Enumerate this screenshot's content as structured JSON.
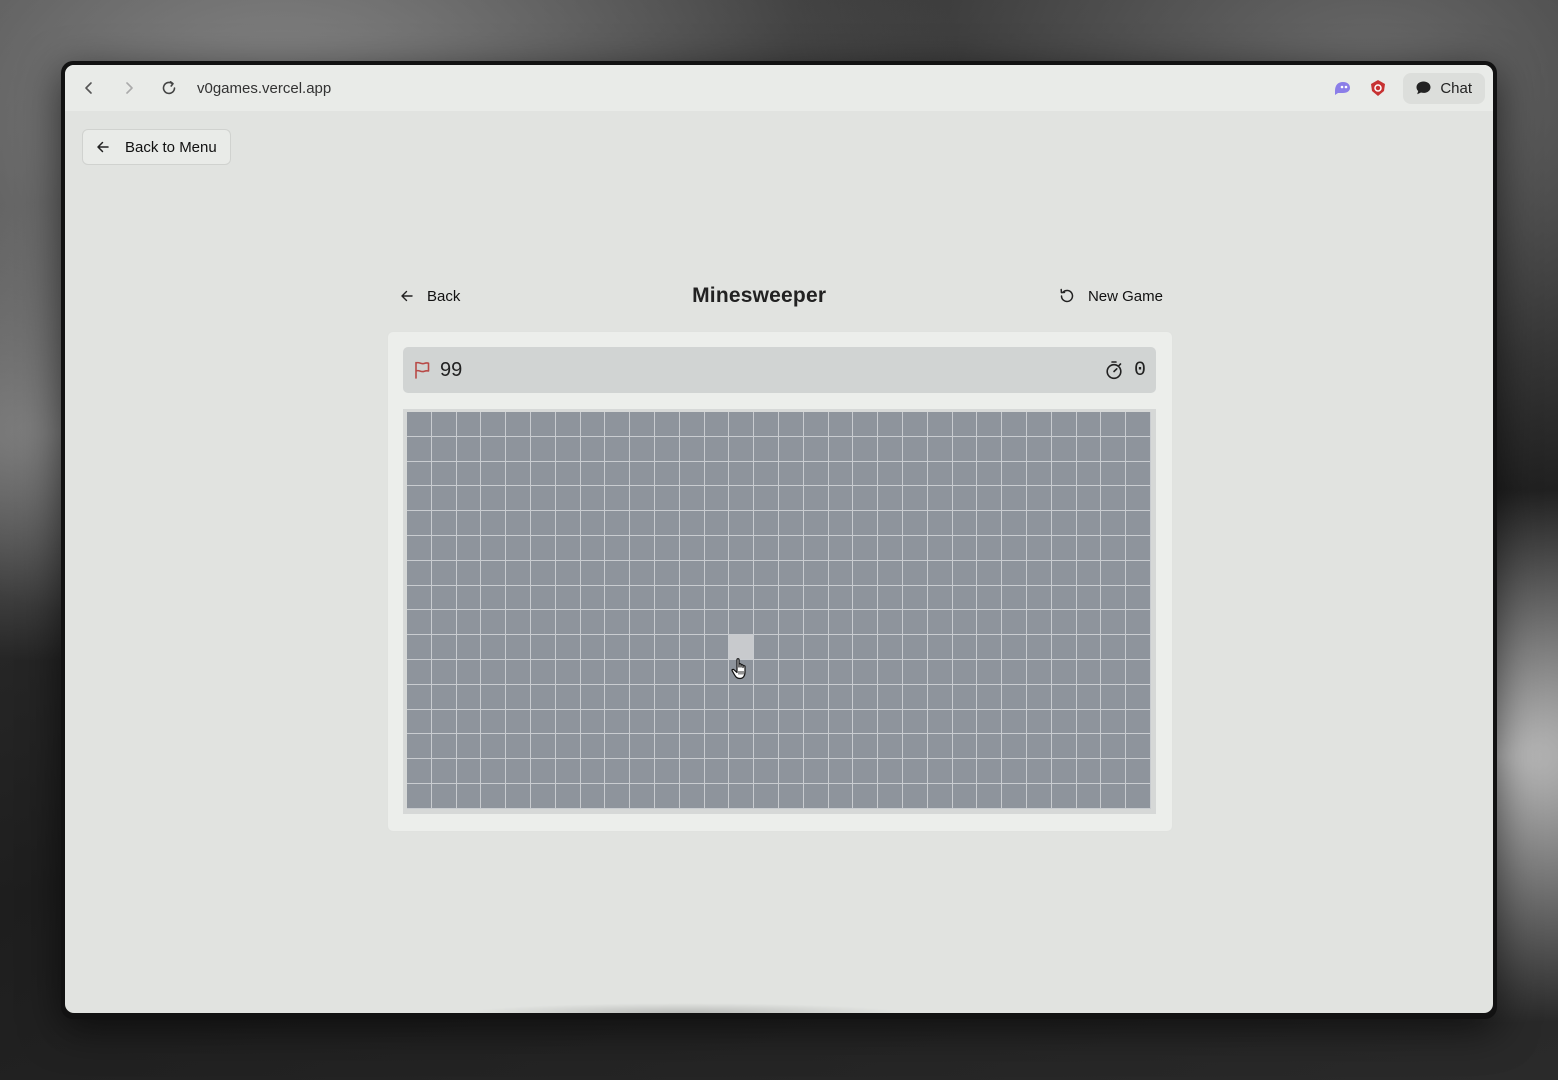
{
  "browser": {
    "url": "v0games.vercel.app",
    "chat_label": "Chat"
  },
  "page": {
    "back_to_menu_label": "Back to Menu",
    "back_label": "Back",
    "title": "Minesweeper",
    "new_game_label": "New Game"
  },
  "status": {
    "flags_remaining": "99",
    "timer": "0"
  },
  "board": {
    "columns": 30,
    "rows": 16,
    "hovered_cell": {
      "row": 9,
      "col": 13
    }
  },
  "colors": {
    "cell_unrevealed": "#8e949c",
    "cell_hover": "#c8cacd",
    "flag": "#c0504d",
    "accent_purple": "#8b7ee8",
    "accent_red": "#d23b3b"
  }
}
